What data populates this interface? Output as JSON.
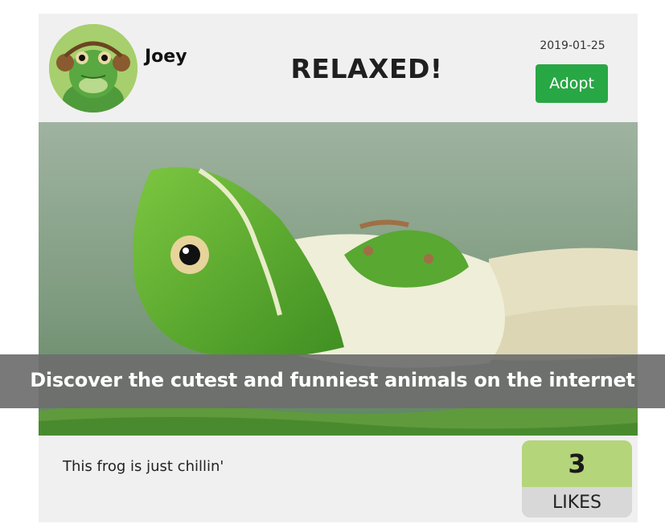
{
  "post": {
    "username": "Joey",
    "title": "RELAXED!",
    "date": "2019-01-25",
    "adopt_label": "Adopt",
    "description": "This frog is just chillin'",
    "likes": {
      "count": "3",
      "label": "LIKES"
    }
  },
  "banner": {
    "text": "Discover the cutest and funniest animals on the internet"
  },
  "colors": {
    "adopt_button": "#28a745",
    "likes_count_bg": "#b4d57a",
    "likes_label_bg": "#d8d8d8",
    "card_bg": "#f0f0f0"
  },
  "icons": {
    "avatar": "frog-with-headphones-avatar",
    "photo": "frog-reclining-on-lily-pad-photo"
  }
}
